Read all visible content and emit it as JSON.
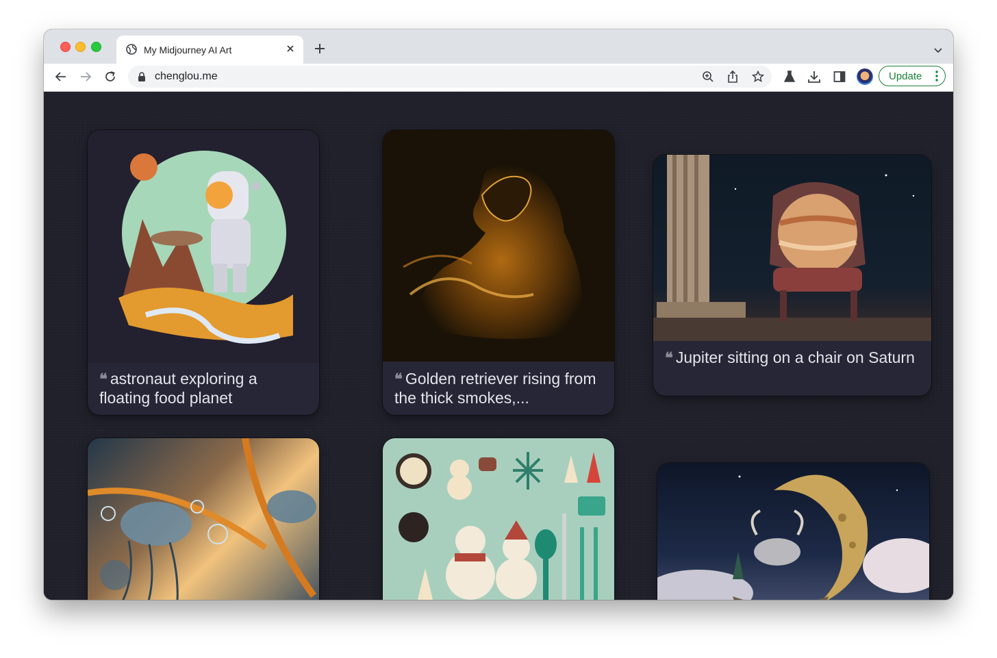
{
  "browser": {
    "tab_title": "My Midjourney AI Art",
    "url": "chenglou.me",
    "update_label": "Update"
  },
  "gallery": {
    "cards": [
      {
        "caption": "astronaut exploring a floating food planet"
      },
      {
        "caption": "Golden retriever rising from the thick smokes,..."
      },
      {
        "caption": "Jupiter sitting on a chair on Saturn"
      },
      {
        "caption": ""
      },
      {
        "caption": ""
      },
      {
        "caption": ""
      }
    ]
  },
  "icons": {
    "quote": "❝"
  },
  "colors": {
    "page_bg": "#1f2029",
    "card_bg": "#262637",
    "update_green": "#188038"
  }
}
